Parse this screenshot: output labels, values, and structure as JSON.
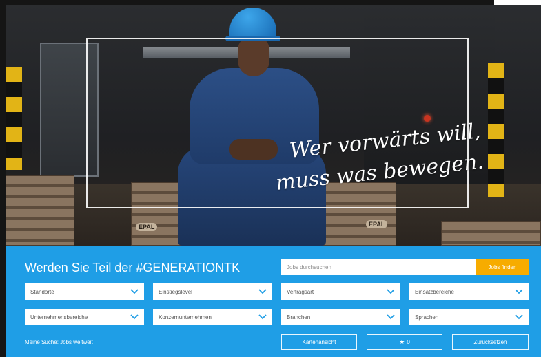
{
  "hero": {
    "slogan_line1": "Wer vorwärts will,",
    "slogan_line2": "muss was bewegen.",
    "pallet_label": "EPAL"
  },
  "search_panel": {
    "title": "Werden Sie Teil der #GENERATIONTK",
    "search_placeholder": "Jobs durchsuchen",
    "search_button": "Jobs finden",
    "filters_row1": [
      "Standorte",
      "Einstiegslevel",
      "Vertragsart",
      "Einsatzbereiche"
    ],
    "filters_row2": [
      "Unternehmensbereiche",
      "Konzernunternehmen",
      "Branchen",
      "Sprachen"
    ],
    "my_search": "Meine Suche: Jobs weltweit",
    "map_view_button": "Kartenansicht",
    "favorites_count": "0",
    "reset_button": "Zurücksetzen"
  },
  "colors": {
    "panel": "#1f9ee6",
    "accent": "#f7ac00",
    "chevron": "#1f9ee6"
  },
  "icons": {
    "dropdown": "chevron-down-icon",
    "favorites": "star-icon"
  }
}
